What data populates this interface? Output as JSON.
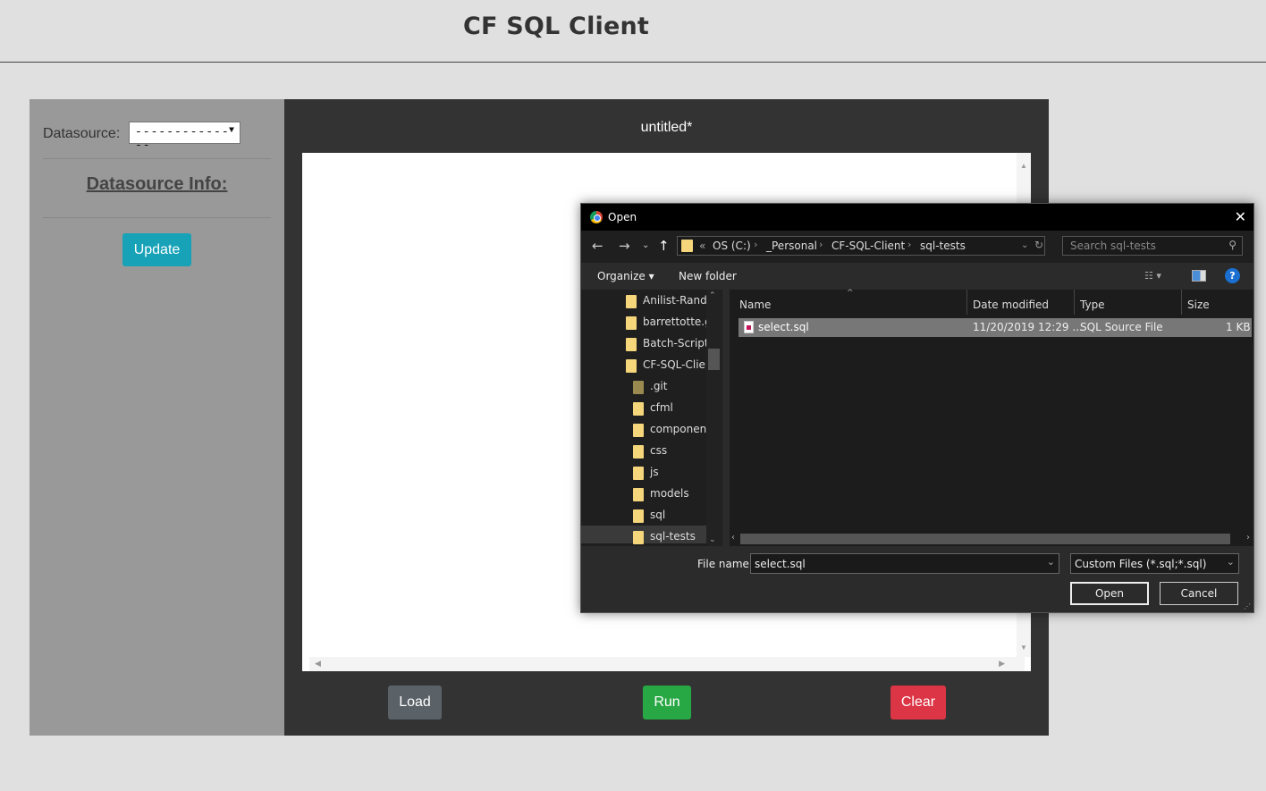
{
  "app": {
    "title": "CF SQL Client"
  },
  "sidebar": {
    "datasource_label": "Datasource:",
    "datasource_value": "--------------",
    "datasource_info_heading": "Datasource Info:",
    "update_label": "Update"
  },
  "editor": {
    "file_name": "untitled*",
    "load_label": "Load",
    "run_label": "Run",
    "clear_label": "Clear"
  },
  "dialog": {
    "title": "Open",
    "close_icon": "close-icon",
    "breadcrumb": [
      "OS (C:)",
      "_Personal",
      "CF-SQL-Client",
      "sql-tests"
    ],
    "breadcrumb_prefix": "«",
    "search_placeholder": "Search sql-tests",
    "organize_label": "Organize ▾",
    "new_folder_label": "New folder",
    "help_label": "?",
    "tree": [
      {
        "label": "Anilist-RandE",
        "level": 0
      },
      {
        "label": "barrettotte.gi",
        "level": 0
      },
      {
        "label": "Batch-Scripts",
        "level": 0
      },
      {
        "label": "CF-SQL-Clier",
        "level": 0
      },
      {
        "label": ".git",
        "level": 1
      },
      {
        "label": "cfml",
        "level": 1
      },
      {
        "label": "component",
        "level": 1
      },
      {
        "label": "css",
        "level": 1
      },
      {
        "label": "js",
        "level": 1
      },
      {
        "label": "models",
        "level": 1
      },
      {
        "label": "sql",
        "level": 1
      },
      {
        "label": "sql-tests",
        "level": 1
      }
    ],
    "columns": {
      "name": "Name",
      "date": "Date modified",
      "type": "Type",
      "size": "Size"
    },
    "files": [
      {
        "name": "select.sql",
        "date": "11/20/2019 12:29 ...",
        "type": "SQL Source File",
        "size": "1 KB"
      }
    ],
    "file_name_label": "File name:",
    "file_name_value": "select.sql",
    "filter_value": "Custom Files (*.sql;*.sql)",
    "open_label": "Open",
    "cancel_label": "Cancel"
  },
  "colors": {
    "update": "#17a2b8",
    "load": "#5a6268",
    "run": "#28a745",
    "clear": "#dc3545"
  }
}
